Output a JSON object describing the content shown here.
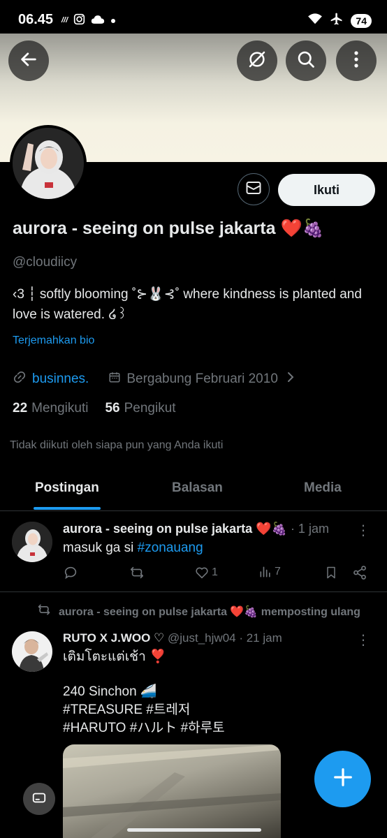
{
  "status_bar": {
    "time": "06.45",
    "battery": "74",
    "left_icons": [
      "hd-signal-icon",
      "instagram-icon",
      "cloud-icon",
      "dot-icon"
    ],
    "right_icons": [
      "wifi-icon",
      "airplane-icon"
    ]
  },
  "header": {
    "icons": [
      "back-arrow-icon",
      "hide-icon",
      "search-icon",
      "more-vertical-icon"
    ]
  },
  "profile": {
    "name": "aurora - seeing on pulse jakarta ❤️🍇",
    "handle": "@cloudiicy",
    "bio": "‹3 ┆ softly blooming ˚⊱🐰⊰˚ where kindness is planted and love is watered. ໒꒱",
    "translate_label": "Terjemahkan bio",
    "link": "businnes.",
    "joined": "Bergabung Februari 2010",
    "following_count": "22",
    "following_label": "Mengikuti",
    "followers_count": "56",
    "followers_label": "Pengikut",
    "not_followed_text": "Tidak diikuti oleh siapa pun yang Anda ikuti",
    "follow_button": "Ikuti"
  },
  "tabs": [
    {
      "label": "Postingan",
      "active": true
    },
    {
      "label": "Balasan",
      "active": false
    },
    {
      "label": "Media",
      "active": false
    }
  ],
  "post1": {
    "author": "aurora - seeing on pulse jakarta ❤️🍇",
    "time": "· 1 jam",
    "text_prefix": "masuk ga si ",
    "hashtag": "#zonauang",
    "likes": "1",
    "views": "7"
  },
  "repost": {
    "reposter": "aurora - seeing on pulse jakarta ❤️🍇",
    "label": "memposting ulang"
  },
  "post2": {
    "author": "RUTO X J.WOO ♡",
    "handle_time": "@just_hjw04 · 21 jam",
    "line1": "เติมโตะแต่เช้า ❣️",
    "line2": "240 Sinchon 🚄",
    "line3_tags": "#TREASURE #트레저",
    "line4_tags": "#HARUTO #ハルト #하루토"
  },
  "colors": {
    "background": "#000000",
    "accent": "#1d9bf0",
    "secondary_text": "#71767b",
    "primary_text": "#e7e9ea"
  }
}
